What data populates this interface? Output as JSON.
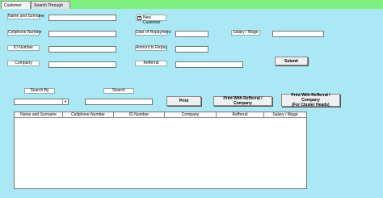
{
  "tabs": [
    {
      "label": "Customer Details"
    },
    {
      "label": "Search Through Loans"
    }
  ],
  "form": {
    "name_label": "Name and Surname",
    "cellphone_label": "Cellphone Number",
    "id_label": "ID Number",
    "company_label": "Company",
    "new_customer_label": "New Customer",
    "new_customer_checked": "✓",
    "repayment_label": "Date of Repayment",
    "amount_label": "Amount to Repay",
    "referral_label": "Refferral",
    "salary_label": "Salary / Wage",
    "submit_label": "Submit"
  },
  "search": {
    "search_by_label": "Search By",
    "search_label": "Search",
    "print_label": "Print",
    "print_referral_label": "Print With Refferral / Company",
    "print_cluster_label_line1": "Print With Refferral / Company",
    "print_cluster_label_line2": "(For Cluster Heads)"
  },
  "table": {
    "columns": [
      "Name and Surname",
      "Cellphone Number",
      "ID Number",
      "Company",
      "Refferral",
      "Salary / Wage"
    ]
  }
}
